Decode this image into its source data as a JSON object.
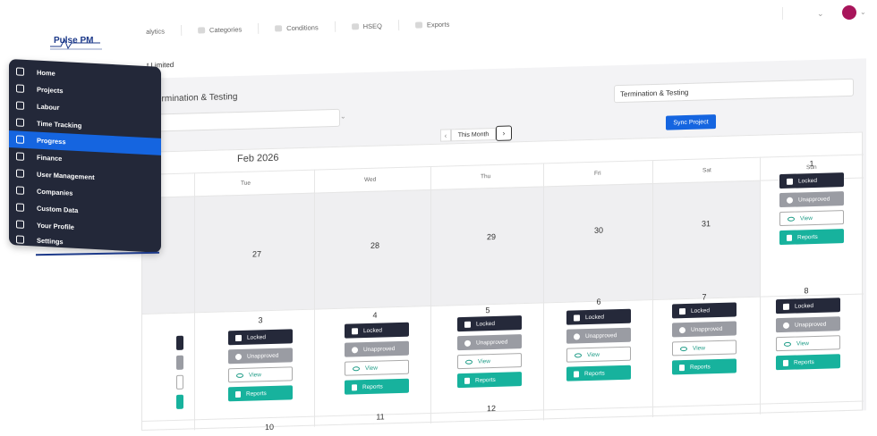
{
  "logo": {
    "text": "Pulse PM"
  },
  "topnav": [
    {
      "label": "alytics",
      "icon": "chart-icon"
    },
    {
      "label": "Categories",
      "icon": "category-icon"
    },
    {
      "label": "Conditions",
      "icon": "cloud-icon"
    },
    {
      "label": "HSEQ",
      "icon": "shield-icon"
    },
    {
      "label": "Exports",
      "icon": "export-icon"
    }
  ],
  "avatar_color": "#a8155b",
  "breadcrumb": "t Limited",
  "filters": {
    "label": "Termination & Testing",
    "right_select": "Termination & Testing",
    "sync_label": "Sync Project"
  },
  "calendar": {
    "month_title": "Feb 2026",
    "this_month_label": "This Month",
    "days_of_week": [
      "Tue",
      "Wed",
      "Thu",
      "Fri",
      "Sat",
      "Sun"
    ],
    "row1": [
      "27",
      "28",
      "29",
      "30",
      "31",
      "1"
    ],
    "row2_top": [
      "3",
      "4",
      "5",
      "6",
      "7",
      "8"
    ],
    "row3": [
      "10",
      "11",
      "12"
    ],
    "status": {
      "locked": "Locked",
      "unapproved": "Unapproved",
      "view": "View",
      "reports": "Reports"
    }
  },
  "sidebar": {
    "items": [
      {
        "label": "Home",
        "icon": "home-icon"
      },
      {
        "label": "Projects",
        "icon": "folder-icon"
      },
      {
        "label": "Labour",
        "icon": "users-icon"
      },
      {
        "label": "Time Tracking",
        "icon": "clock-icon"
      },
      {
        "label": "Progress",
        "icon": "calendar-icon"
      },
      {
        "label": "Finance",
        "icon": "money-icon"
      },
      {
        "label": "User Management",
        "icon": "user-manage-icon"
      },
      {
        "label": "Companies",
        "icon": "building-icon"
      },
      {
        "label": "Custom Data",
        "icon": "code-icon"
      },
      {
        "label": "Your Profile",
        "icon": "profile-icon"
      },
      {
        "label": "Settings",
        "icon": "gear-icon"
      }
    ],
    "active_index": 4
  },
  "colors": {
    "primary": "#1565e0",
    "sidebar_bg": "#232839",
    "locked": "#25293a",
    "unapproved": "#9a9ca3",
    "reports": "#17b29d"
  }
}
